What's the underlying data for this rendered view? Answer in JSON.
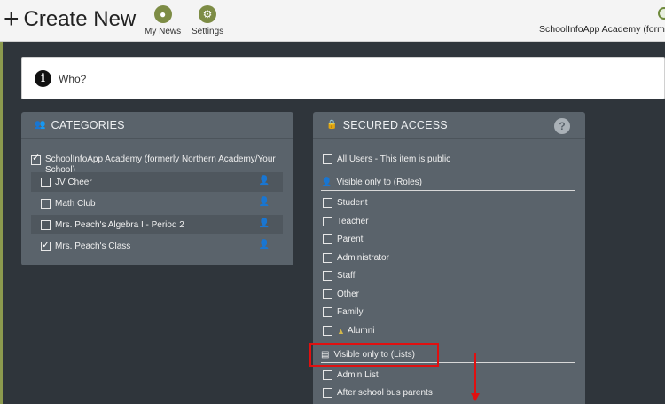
{
  "header": {
    "plus_icon": "+",
    "title": "Create New",
    "nav": [
      {
        "label": "My News",
        "icon": "person-icon"
      },
      {
        "label": "Settings",
        "icon": "gear-icon"
      }
    ],
    "school_name": "SchoolInfoApp Academy (former"
  },
  "who": {
    "icon": "info-icon",
    "label": "Who?"
  },
  "categories": {
    "title": "CATEGORIES",
    "icon": "users-icon",
    "top": {
      "label": "SchoolInfoApp Academy (formerly Northern Academy/Your School)",
      "checked": true
    },
    "items": [
      {
        "label": "JV Cheer",
        "checked": false
      },
      {
        "label": "Math Club",
        "checked": false
      },
      {
        "label": "Mrs. Peach's Algebra I - Period 2",
        "checked": false
      },
      {
        "label": "Mrs. Peach's Class",
        "checked": true
      }
    ]
  },
  "secured": {
    "title": "SECURED ACCESS",
    "icon": "lock-icon",
    "help": "?",
    "all_users": "All Users - This item is public",
    "roles_heading": "Visible only to (Roles)",
    "roles": [
      "Student",
      "Teacher",
      "Parent",
      "Administrator",
      "Staff",
      "Other",
      "Family",
      "Alumni"
    ],
    "lists_heading": "Visible only to (Lists)",
    "lists": [
      "Admin List",
      "After school bus parents"
    ]
  },
  "colors": {
    "accent_green": "#7d8c45",
    "panel": "#5a636b",
    "highlight_red": "#e01010"
  }
}
